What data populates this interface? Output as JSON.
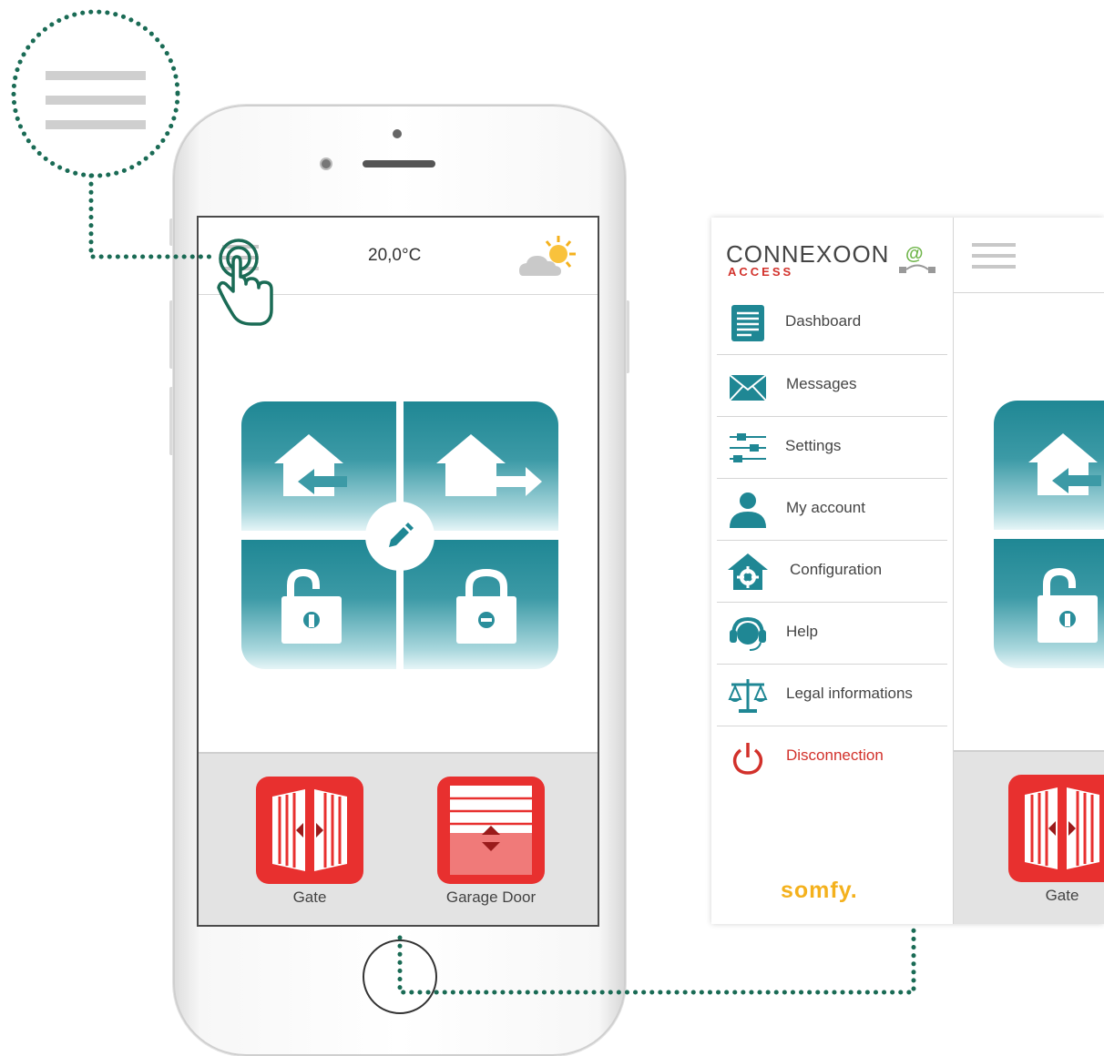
{
  "phone": {
    "temperature": "20,0°C",
    "devices": [
      {
        "label": "Gate"
      },
      {
        "label": "Garage Door"
      }
    ]
  },
  "panel": {
    "logo": {
      "main": "CONNEXOON",
      "sub": "ACCESS"
    },
    "menu": [
      {
        "label": "Dashboard",
        "icon": "dashboard-icon"
      },
      {
        "label": "Messages",
        "icon": "envelope-icon"
      },
      {
        "label": "Settings",
        "icon": "sliders-icon"
      },
      {
        "label": "My account",
        "icon": "user-icon"
      },
      {
        "label": "Configuration",
        "icon": "house-gear-icon"
      },
      {
        "label": "Help",
        "icon": "headset-icon"
      },
      {
        "label": "Legal informations",
        "icon": "scales-icon"
      },
      {
        "label": "Disconnection",
        "icon": "power-icon"
      }
    ],
    "brand": "somfy.",
    "device_label": "Gate"
  },
  "colors": {
    "teal": "#1f8794",
    "red": "#e8302f",
    "callout_green": "#1a6b55",
    "disconnect_red": "#d2312b",
    "somfy_yellow": "#f4b11d"
  }
}
